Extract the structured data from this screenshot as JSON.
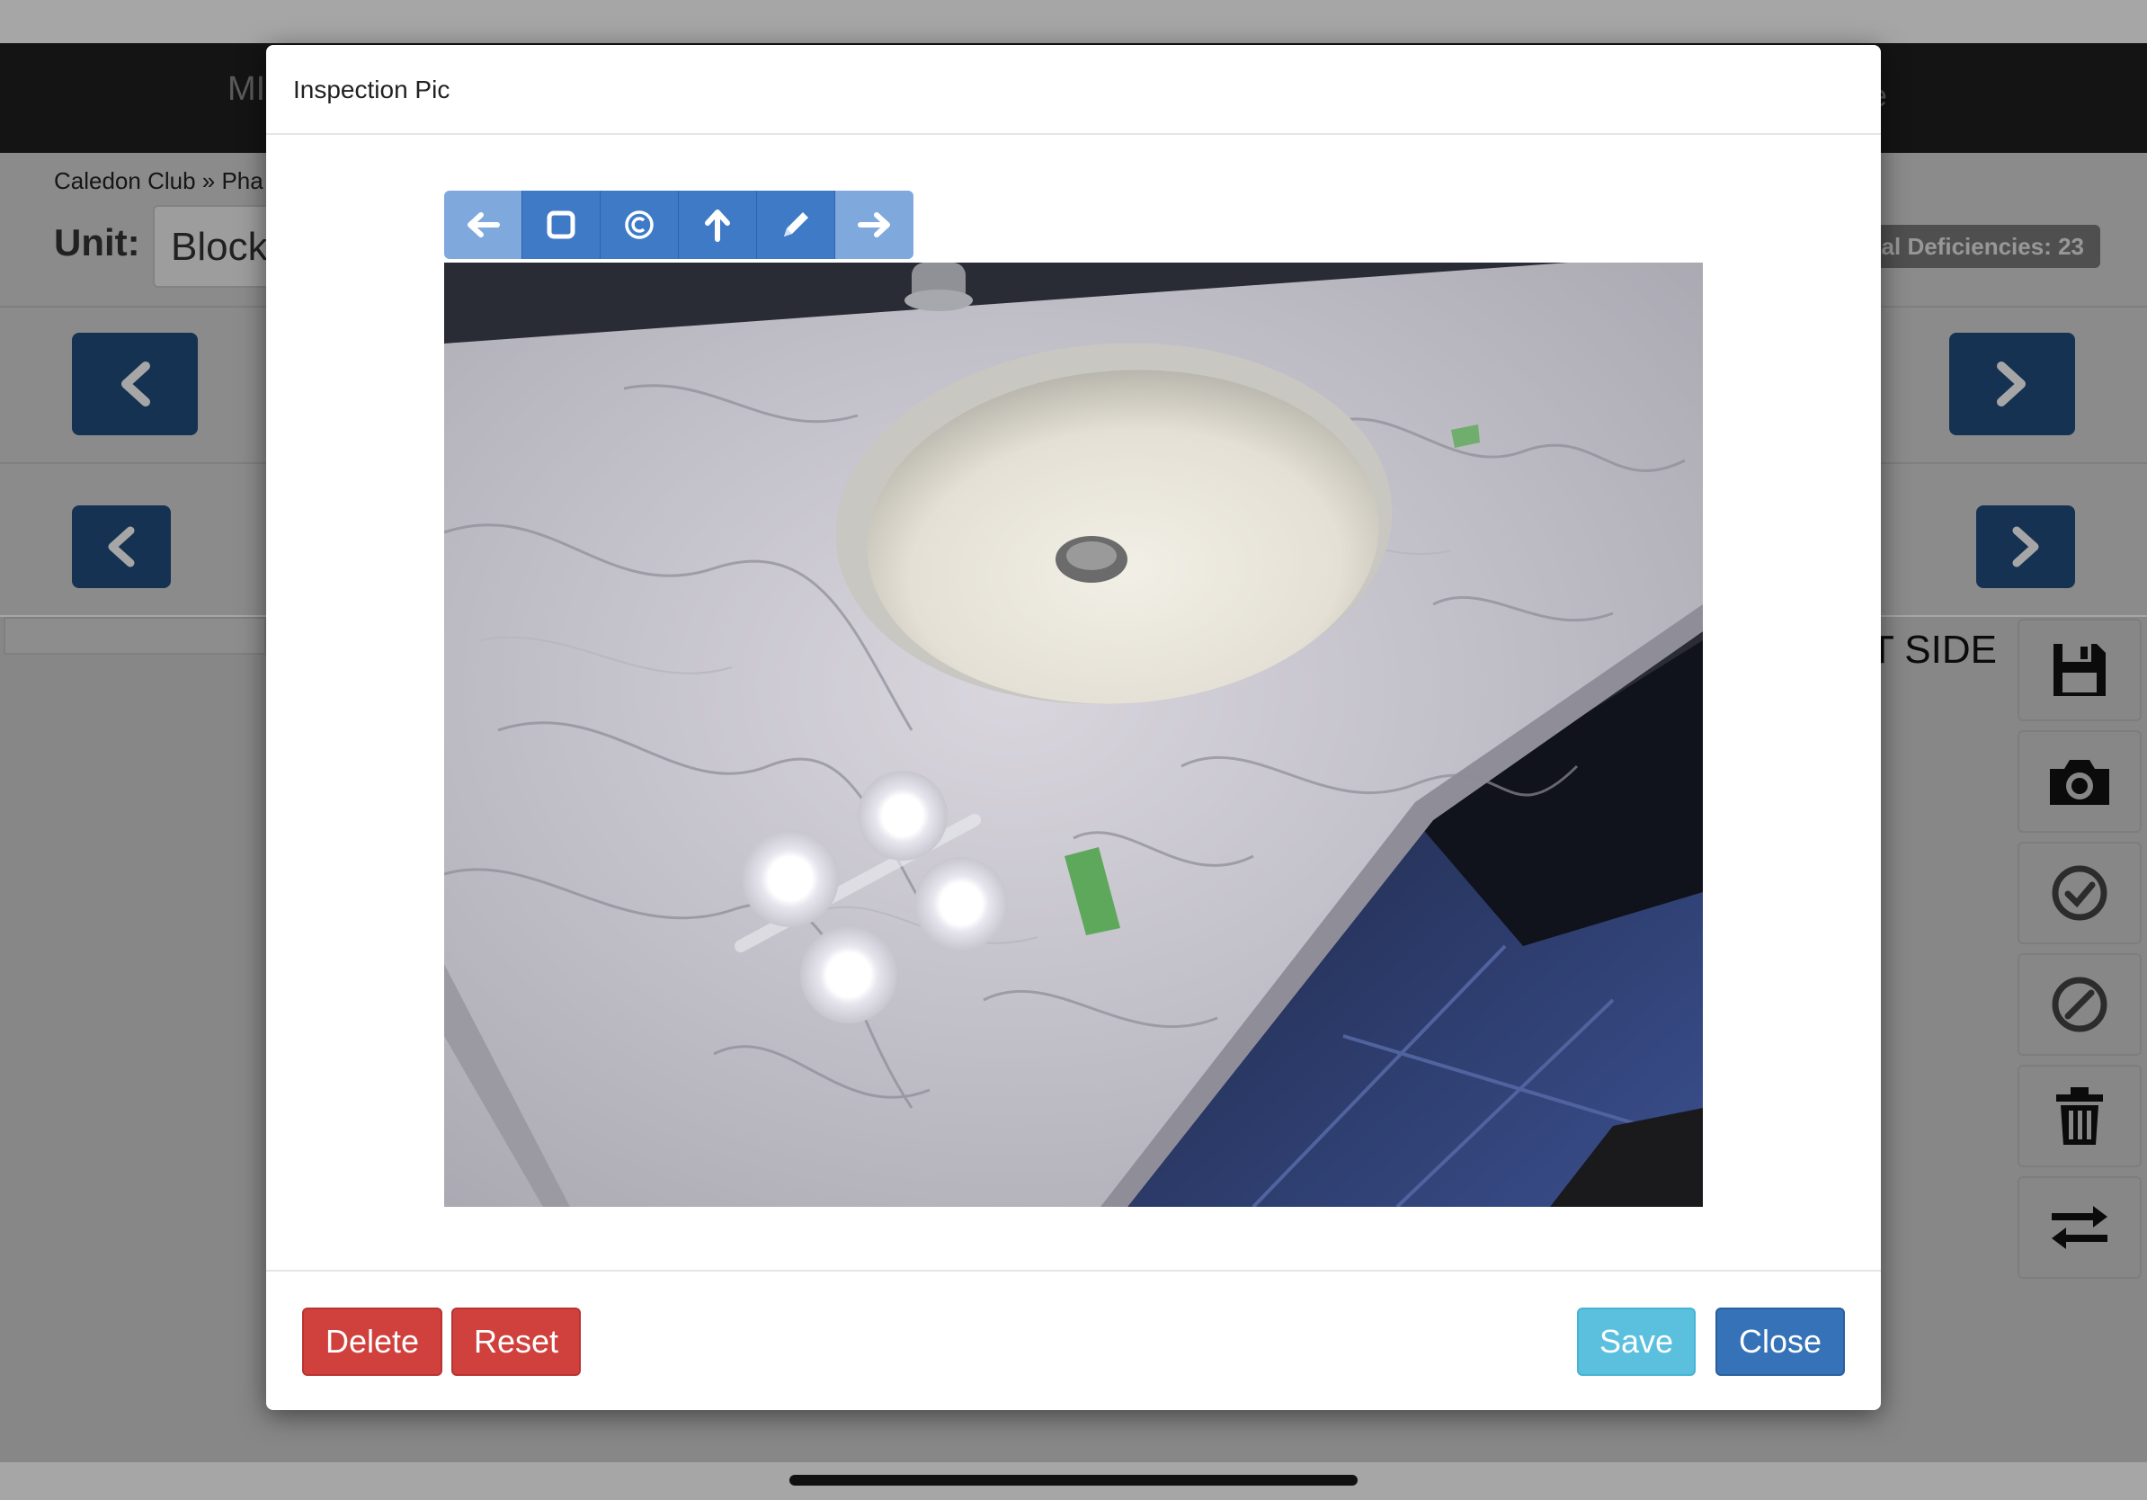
{
  "background": {
    "menu_left": "MI",
    "menu_right": "e",
    "breadcrumb": "Caledon Club » Pha",
    "unit_label": "Unit:",
    "unit_value": "Block",
    "total_deficiencies": "otal Deficiencies: 23",
    "side_text": "T SIDE"
  },
  "modal": {
    "title": "Inspection Pic",
    "toolbar_icons": [
      "arrow-left-icon",
      "square-icon",
      "circle-icon",
      "arrow-up-icon",
      "pencil-icon",
      "arrow-right-icon"
    ],
    "footer": {
      "delete_label": "Delete",
      "reset_label": "Reset",
      "save_label": "Save",
      "close_label": "Close"
    }
  },
  "colors": {
    "danger": "#d0413d",
    "info": "#5bc0de",
    "primary": "#3672b8",
    "nav": "#234d7e"
  }
}
